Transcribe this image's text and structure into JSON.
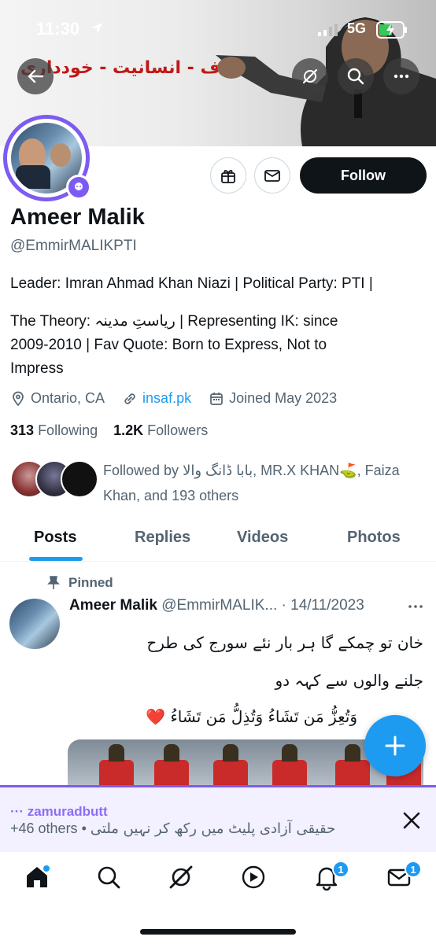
{
  "status": {
    "time": "11:30",
    "network": "5G"
  },
  "banner": {
    "urdu_text": "انصاف - انسانیت - خودداری"
  },
  "profile": {
    "name": "Ameer Malik",
    "handle": "@EmmirMALIKPTI",
    "bio_line1": "Leader: Imran Ahmad Khan Niazi | Political Party: PTI |",
    "bio_line2": "The Theory: ریاستِ مدینہ | Representing IK: since",
    "bio_line3": "2009-2010 | Fav Quote: Born to Express, Not to",
    "bio_line4": "Impress",
    "location": "Ontario, CA",
    "website": "insaf.pk",
    "joined": "Joined May 2023",
    "following_count": "313",
    "following_label": "Following",
    "followers_count": "1.2K",
    "followers_label": "Followers",
    "followed_by_line1": "Followed by بابا ڈانگ والا, MR.X KHAN⛳, Faiza",
    "followed_by_line2": "Khan, and 193 others",
    "follow_label": "Follow"
  },
  "tabs": [
    {
      "label": "Posts",
      "active": true
    },
    {
      "label": "Replies",
      "active": false
    },
    {
      "label": "Videos",
      "active": false
    },
    {
      "label": "Photos",
      "active": false
    }
  ],
  "post": {
    "pinned_label": "Pinned",
    "author": "Ameer Malik",
    "handle_date": "@EmmirMALIK... · 14/11/2023",
    "line1": "خان تو چمکے گا ہر بار نئے سورج کی طرح",
    "line2": "جلنے والوں سے کہہ دو",
    "line3": "وَتُعِزُّ مَن تَشَاءُ وَتُذِلُّ مَن تَشَاءُ ❤️"
  },
  "space": {
    "host": "··· zamuradbutt",
    "others": "+46 others",
    "title": "حقیقی آزادی پلیٹ میں رکھ کر نہیں ملتی"
  },
  "nav": {
    "notifications_badge": "1",
    "messages_badge": "1"
  },
  "colors": {
    "accent": "#1d9bf0",
    "spaces_purple": "#7c5cf0",
    "banner_red": "#c01818"
  }
}
